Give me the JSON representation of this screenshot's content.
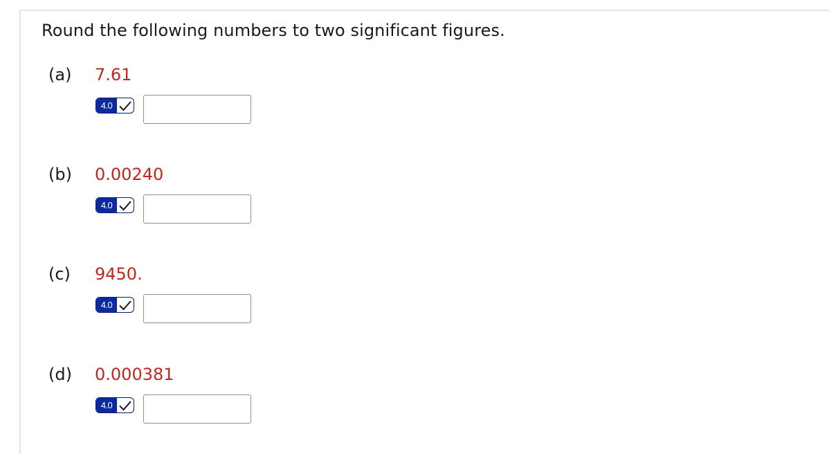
{
  "question": {
    "prompt": "Round the following numbers to two significant figures."
  },
  "parts": [
    {
      "label": "(a)",
      "value": "7.61",
      "badge": "4.0",
      "answer": ""
    },
    {
      "label": "(b)",
      "value": "0.00240",
      "badge": "4.0",
      "answer": ""
    },
    {
      "label": "(c)",
      "value": "9450.",
      "badge": "4.0",
      "answer": ""
    },
    {
      "label": "(d)",
      "value": "0.000381",
      "badge": "4.0",
      "answer": ""
    }
  ],
  "colors": {
    "value_text": "#c0281f",
    "badge_fill": "#0b2aa0"
  },
  "icons": {
    "badge_check": "checkmark-icon"
  }
}
